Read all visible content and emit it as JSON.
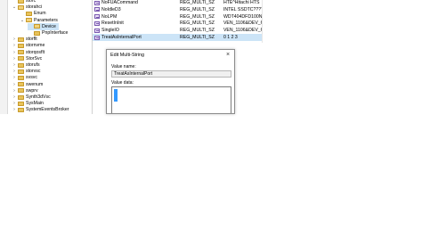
{
  "tree": {
    "items": [
      {
        "label": "storc",
        "depth": 2,
        "expander": "",
        "open": false,
        "selected": false
      },
      {
        "label": "storahci",
        "depth": 2,
        "expander": "⌄",
        "open": true,
        "selected": false
      },
      {
        "label": "Enum",
        "depth": 3,
        "expander": "",
        "open": false,
        "selected": false
      },
      {
        "label": "Parameters",
        "depth": 3,
        "expander": "⌄",
        "open": true,
        "selected": false
      },
      {
        "label": "Device",
        "depth": 4,
        "expander": "",
        "open": true,
        "selected": true
      },
      {
        "label": "PnpInterface",
        "depth": 4,
        "expander": "",
        "open": false,
        "selected": false
      },
      {
        "label": "storflt",
        "depth": 2,
        "expander": "›",
        "open": false,
        "selected": false
      },
      {
        "label": "stornvme",
        "depth": 2,
        "expander": "›",
        "open": false,
        "selected": false
      },
      {
        "label": "storqosflt",
        "depth": 2,
        "expander": "›",
        "open": false,
        "selected": false
      },
      {
        "label": "StorSvc",
        "depth": 2,
        "expander": "›",
        "open": false,
        "selected": false
      },
      {
        "label": "storufs",
        "depth": 2,
        "expander": "›",
        "open": false,
        "selected": false
      },
      {
        "label": "storvsc",
        "depth": 2,
        "expander": "›",
        "open": false,
        "selected": false
      },
      {
        "label": "svsvc",
        "depth": 2,
        "expander": "›",
        "open": false,
        "selected": false
      },
      {
        "label": "swenum",
        "depth": 2,
        "expander": "›",
        "open": false,
        "selected": false
      },
      {
        "label": "swprv",
        "depth": 2,
        "expander": "›",
        "open": false,
        "selected": false
      },
      {
        "label": "Synth3dVsc",
        "depth": 2,
        "expander": "›",
        "open": false,
        "selected": false
      },
      {
        "label": "SysMain",
        "depth": 2,
        "expander": "›",
        "open": false,
        "selected": false
      },
      {
        "label": "SystemEventsBroker",
        "depth": 2,
        "expander": "›",
        "open": false,
        "selected": false
      }
    ]
  },
  "values": {
    "rows": [
      {
        "name": "NoFUACommand",
        "type": "REG_MULTI_SZ",
        "data": "HTE^Hitachi HTS",
        "selected": false
      },
      {
        "name": "NoIdleD3",
        "type": "REG_MULTI_SZ",
        "data": "INTEL SSDTC?????Aa",
        "selected": false
      },
      {
        "name": "NoLPM",
        "type": "REG_MULTI_SZ",
        "data": "WDT404DFD100NLR",
        "selected": false
      },
      {
        "name": "ResetInInit",
        "type": "REG_MULTI_SZ",
        "data": "VEN_1106&DEV_620",
        "selected": false
      },
      {
        "name": "SingleIO",
        "type": "REG_MULTI_SZ",
        "data": "VEN_1106&DEV_620",
        "selected": false
      },
      {
        "name": "TreatAsInternalPort",
        "type": "REG_MULTI_SZ",
        "data": "0 1 2 3",
        "selected": true
      }
    ]
  },
  "dialog": {
    "title": "Edit Multi-String",
    "close_glyph": "×",
    "value_name_label": "Value name:",
    "value_name": "TreatAsInternalPort",
    "value_data_label": "Value data:"
  },
  "colors": {
    "selection": "#cce4f7",
    "text_selection": "#3399ff",
    "folder": "#e8c35a"
  }
}
